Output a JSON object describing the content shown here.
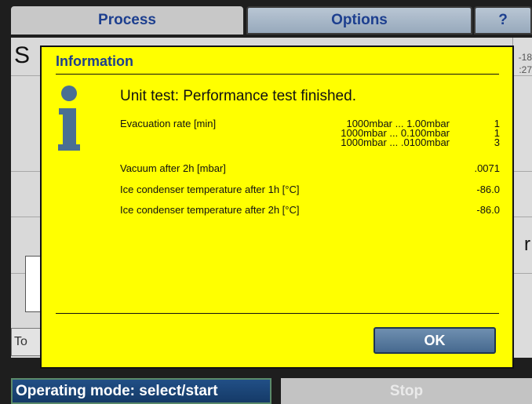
{
  "tabs": [
    {
      "label": "Process"
    },
    {
      "label": "Options"
    },
    {
      "label": "?"
    }
  ],
  "background": {
    "title_fragment": "S",
    "numbers": [
      "-18",
      ":27"
    ],
    "right_letter": "r",
    "to_button": "To"
  },
  "dialog": {
    "title": "Information",
    "heading": "Unit test: Performance test finished.",
    "evacuation": {
      "label": "Evacuation rate [min]",
      "ranges": [
        "1000mbar ... 1.00mbar",
        "1000mbar ... 0.100mbar",
        "1000mbar ... .0100mbar"
      ],
      "values": [
        "1",
        "1",
        "3"
      ]
    },
    "rows": [
      {
        "label": "Vacuum after 2h [mbar]",
        "value": ".0071"
      },
      {
        "label": "Ice condenser temperature after 1h [°C]",
        "value": "-86.0"
      },
      {
        "label": "Ice condenser temperature after 2h [°C]",
        "value": "-86.0"
      }
    ],
    "ok_label": "OK"
  },
  "bottom": {
    "mode_label": "Operating mode: select/start",
    "stop_label": "Stop"
  },
  "colors": {
    "dialog_bg": "#ffff00",
    "accent_blue": "#1d3f8f"
  },
  "icons": [
    "info-icon"
  ]
}
